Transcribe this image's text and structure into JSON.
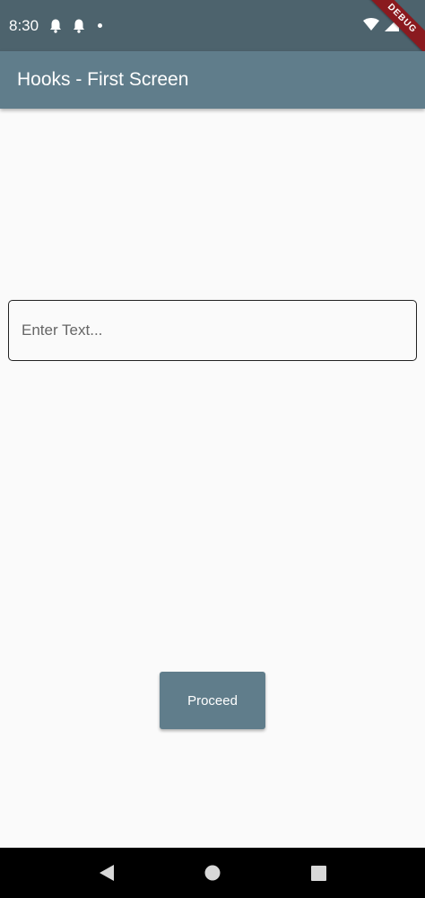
{
  "status_bar": {
    "time": "8:30",
    "icons": [
      "bell-icon",
      "bell-icon",
      "dot-icon",
      "wifi-icon",
      "signal-icon",
      "battery-icon"
    ]
  },
  "debug_banner": "DEBUG",
  "app_bar": {
    "title": "Hooks - First Screen",
    "color": "#607d8b"
  },
  "text_field": {
    "placeholder": "Enter Text...",
    "value": ""
  },
  "proceed_button": {
    "label": "Proceed"
  },
  "nav_bar": {
    "icons": [
      "back-icon",
      "home-icon",
      "recents-icon"
    ]
  }
}
